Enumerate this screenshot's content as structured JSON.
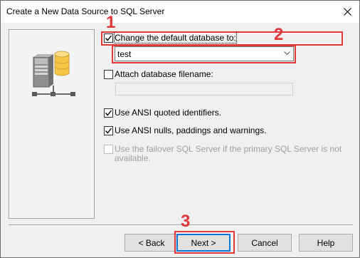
{
  "window": {
    "title": "Create a New Data Source to SQL Server"
  },
  "options": {
    "change_default_db": {
      "label": "Change the default database to:",
      "checked": true
    },
    "database_value": "test",
    "attach_db": {
      "label": "Attach database filename:",
      "checked": false
    },
    "ansi_quoted": {
      "label": "Use ANSI quoted identifiers.",
      "checked": true
    },
    "ansi_nulls": {
      "label": "Use ANSI nulls, paddings and warnings.",
      "checked": true
    },
    "failover": {
      "label": "Use the failover SQL Server if the primary SQL Server is not available.",
      "label_line1": "Use the failover SQL Server if the primary SQL Server is not",
      "label_line2": "available.",
      "checked": false,
      "enabled": false
    }
  },
  "buttons": {
    "back": "< Back",
    "next": "Next >",
    "cancel": "Cancel",
    "help": "Help"
  },
  "annotations": {
    "step1": "1",
    "step2": "2",
    "step3": "3",
    "color": "#e0383b"
  },
  "icons": [
    "close-icon",
    "database-server-icon",
    "dropdown-arrow-icon",
    "checkmark-icon"
  ]
}
